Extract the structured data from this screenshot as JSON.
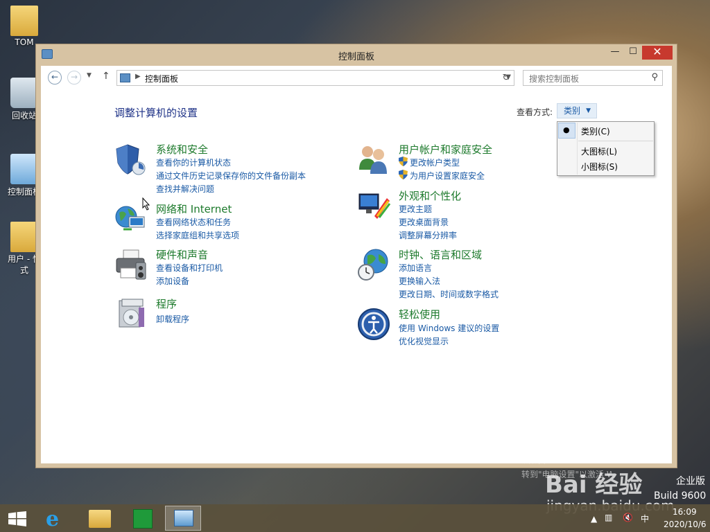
{
  "desktop": {
    "icons": [
      {
        "label": "TOM"
      },
      {
        "label": "回收站"
      },
      {
        "label": "控制面板"
      },
      {
        "label": "用户 - 快\n式"
      }
    ]
  },
  "window": {
    "title": "控制面板",
    "buttons": {
      "minimize": "—",
      "maximize": "☐",
      "close": "✕"
    }
  },
  "toolbar": {
    "breadcrumb": "控制面板",
    "search_placeholder": "搜索控制面板"
  },
  "page": {
    "heading": "调整计算机的设置",
    "view_by_label": "查看方式:",
    "view_by_value": "类别",
    "view_menu": [
      {
        "label": "类别(C)",
        "selected": true
      },
      {
        "label": "大图标(L)",
        "selected": false
      },
      {
        "label": "小图标(S)",
        "selected": false
      }
    ]
  },
  "categories": {
    "system": {
      "title": "系统和安全",
      "links": [
        "查看你的计算机状态",
        "通过文件历史记录保存你的文件备份副本",
        "查找并解决问题"
      ]
    },
    "network": {
      "title": "网络和 Internet",
      "links": [
        "查看网络状态和任务",
        "选择家庭组和共享选项"
      ]
    },
    "hardware": {
      "title": "硬件和声音",
      "links": [
        "查看设备和打印机",
        "添加设备"
      ]
    },
    "programs": {
      "title": "程序",
      "links": [
        "卸载程序"
      ]
    },
    "users": {
      "title": "用户帐户和家庭安全",
      "links": [
        "更改帐户类型",
        "为用户设置家庭安全"
      ]
    },
    "appearance": {
      "title": "外观和个性化",
      "links": [
        "更改主题",
        "更改桌面背景",
        "调整屏幕分辨率"
      ]
    },
    "clock": {
      "title": "时钟、语言和区域",
      "links": [
        "添加语言",
        "更换输入法",
        "更改日期、时间或数字格式"
      ]
    },
    "ease": {
      "title": "轻松使用",
      "links": [
        "使用 Windows 建议的设置",
        "优化视觉显示"
      ]
    }
  },
  "watermark": {
    "activate": "激活 Windows",
    "activate_sub": "转到\"电脑设置\"以激活 Windows。",
    "edition": "企业版",
    "build": "Build 9600",
    "site": "jingyan.baidu.com",
    "baidu": "Bai 经验"
  },
  "taskbar": {
    "time": "16:09",
    "date": "2020/10/6",
    "ime": "中"
  },
  "colors": {
    "link": "#1a5aa5",
    "category_title": "#1d7a2c",
    "heading": "#1e3287",
    "close_button": "#c7392e"
  }
}
